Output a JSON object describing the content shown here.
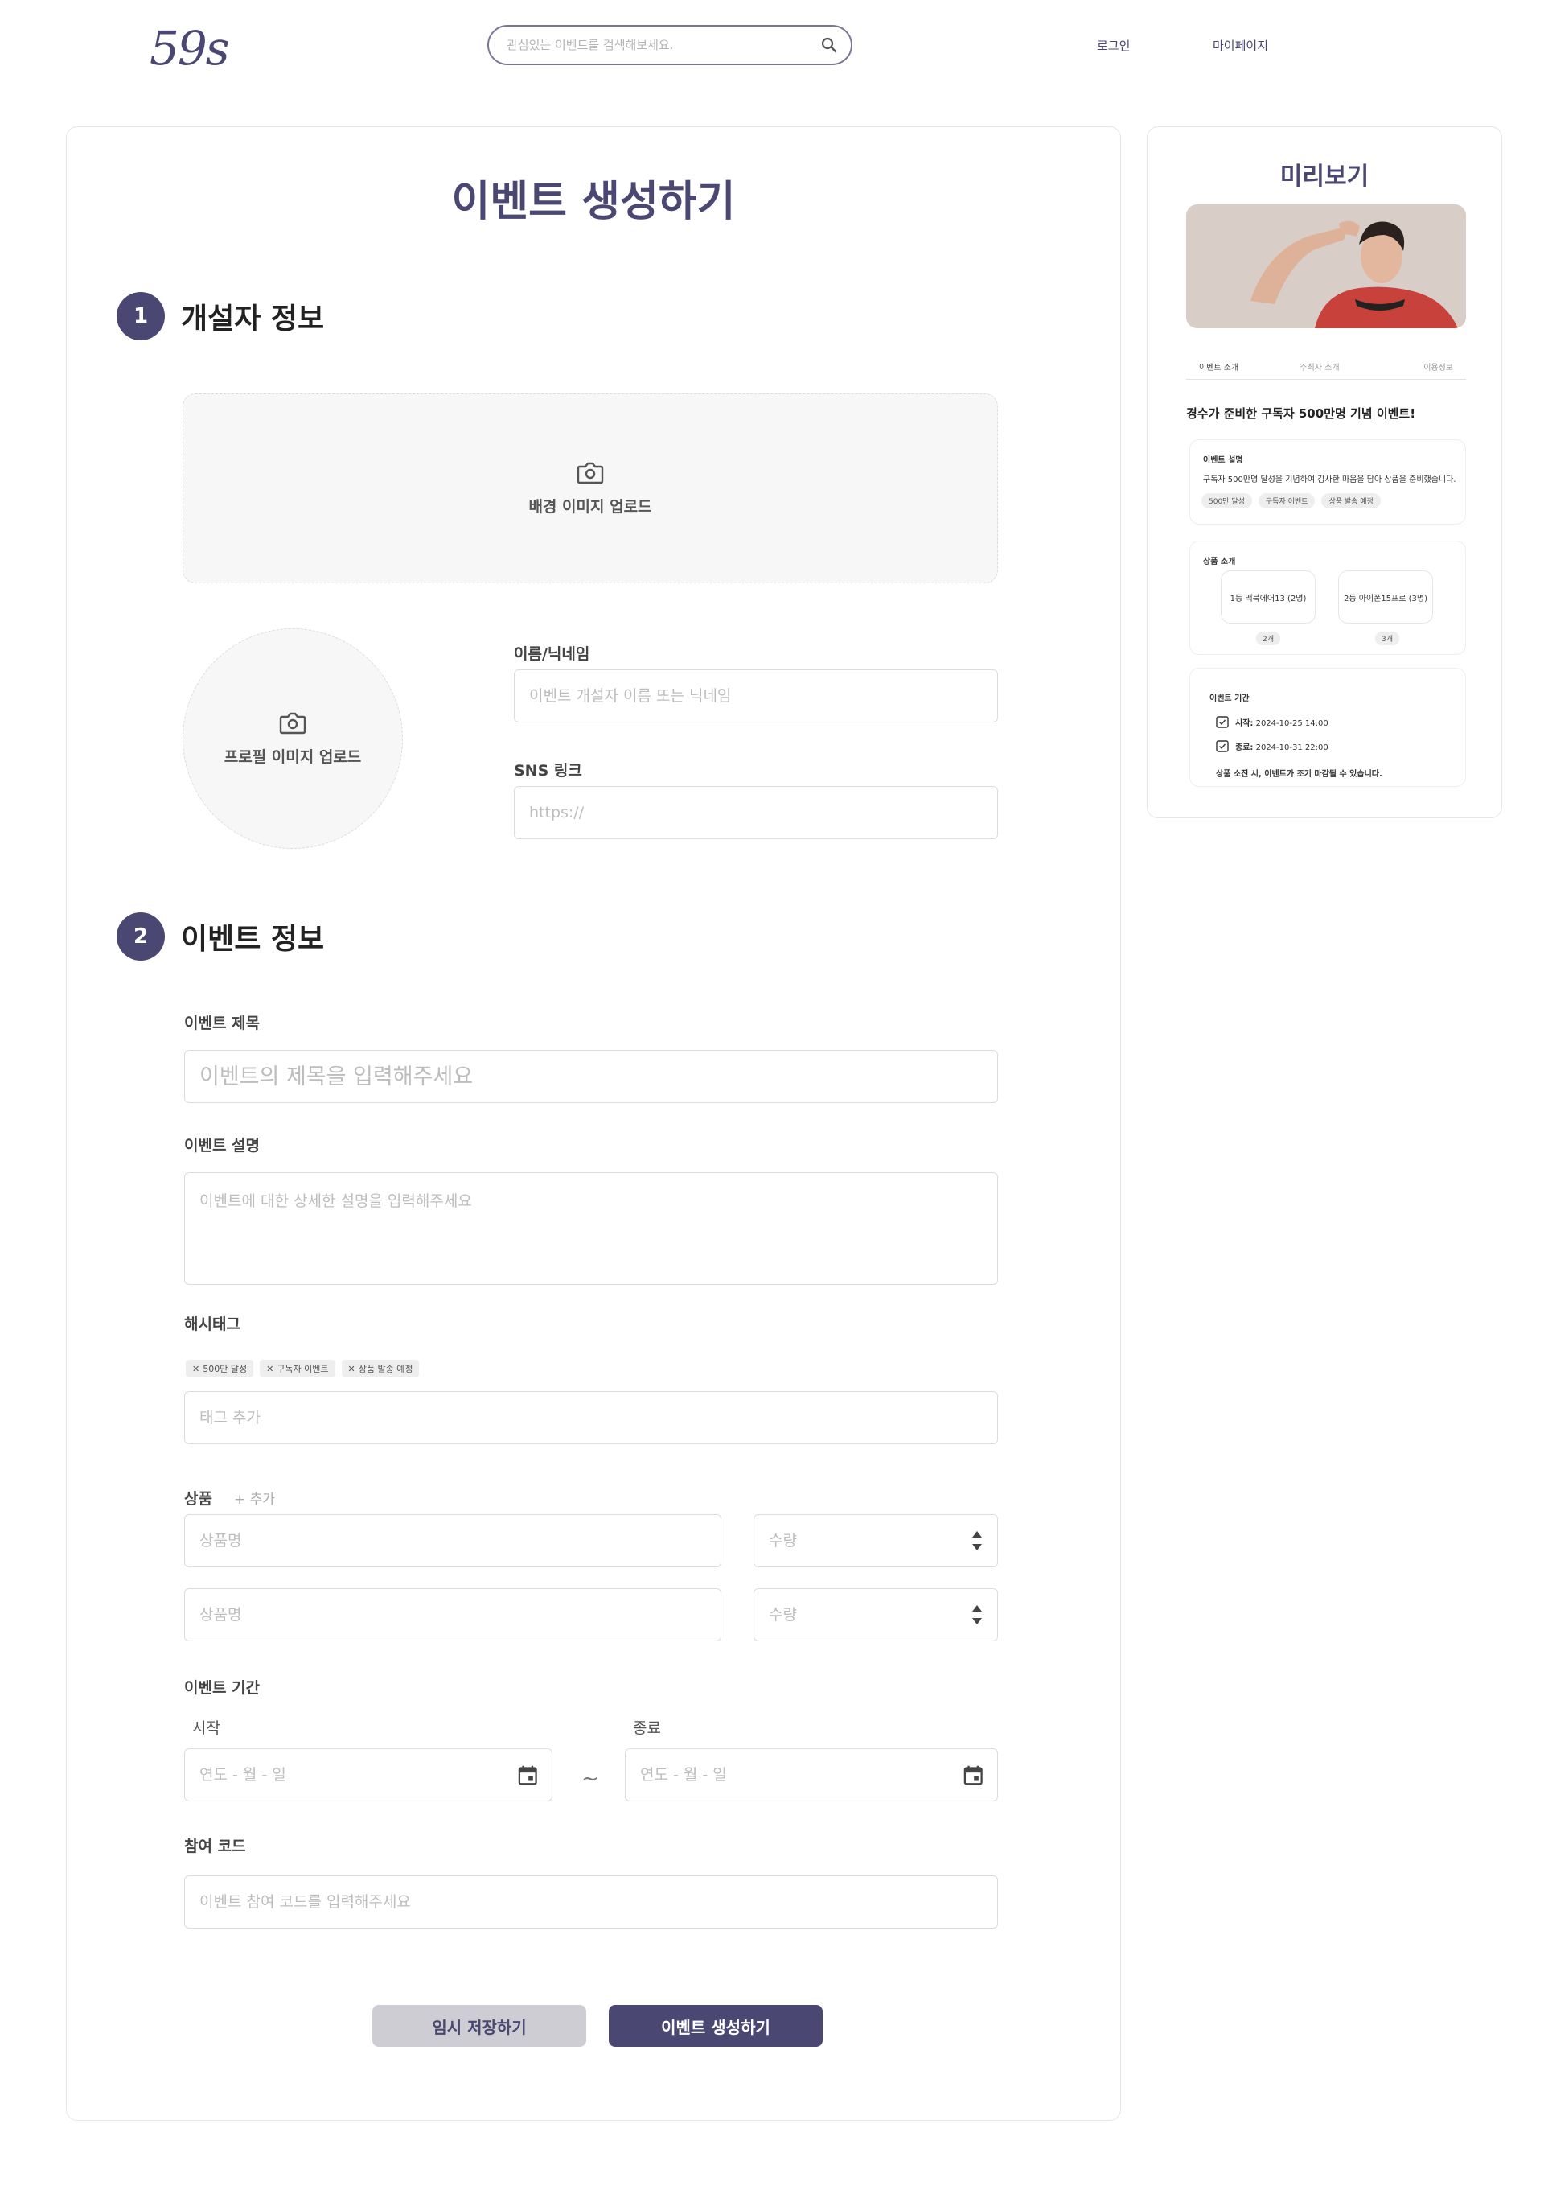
{
  "header": {
    "logo": "59s",
    "search_placeholder": "관심있는 이벤트를 검색해보세요.",
    "nav_login": "로그인",
    "nav_mypage": "마이페이지"
  },
  "form": {
    "page_title": "이벤트 생성하기",
    "section1": {
      "step": "1",
      "title": "개설자 정보"
    },
    "background_upload_label": "배경 이미지 업로드",
    "profile_upload_label": "프로필 이미지 업로드",
    "name_label": "이름/닉네임",
    "name_placeholder": "이벤트 개설자 이름 또는 닉네임",
    "sns_label": "SNS 링크",
    "sns_placeholder": "https://",
    "section2": {
      "step": "2",
      "title": "이벤트 정보"
    },
    "event_title_label": "이벤트 제목",
    "event_title_placeholder": "이벤트의 제목을 입력해주세요",
    "event_desc_label": "이벤트 설명",
    "event_desc_placeholder": "이벤트에 대한 상세한 설명을 입력해주세요",
    "hashtag_label": "해시태그",
    "hashtags": [
      "500만 달성",
      "구독자 이벤트",
      "상품 발송 예정"
    ],
    "tag_placeholder": "태그 추가",
    "product_label": "상품",
    "product_add": "+ 추가",
    "product_rows": [
      {
        "name_placeholder": "상품명",
        "qty_placeholder": "수량"
      },
      {
        "name_placeholder": "상품명",
        "qty_placeholder": "수량"
      }
    ],
    "period_label": "이벤트 기간",
    "start_label": "시작",
    "end_label": "종료",
    "date_placeholder": "연도 - 월 - 일",
    "tilde": "~",
    "code_label": "참여 코드",
    "code_placeholder": "이벤트 참여 코드를 입력해주세요",
    "btn_draft": "임시 저장하기",
    "btn_create": "이벤트 생성하기"
  },
  "preview": {
    "title": "미리보기",
    "tabs": [
      "이벤트 소개",
      "주최자 소개",
      "이용정보"
    ],
    "headline": "경수가 준비한 구독자 500만명 기념 이벤트!",
    "desc_card": {
      "title": "이벤트 설명",
      "text": "구독자 500만명 달성을 기념하여 감사한 마음을 담아 상품을 준비했습니다.",
      "tags": [
        "500만 달성",
        "구독자 이벤트",
        "상품 발송 예정"
      ]
    },
    "product_card": {
      "title": "상품 소개",
      "items": [
        {
          "name": "1등 맥북에어13 (2명)",
          "count": "2개"
        },
        {
          "name": "2등 아이폰15프로 (3명)",
          "count": "3개"
        }
      ]
    },
    "period_card": {
      "title": "이벤트 기간",
      "start_label": "시작:",
      "start_value": "2024-10-25 14:00",
      "end_label": "종료:",
      "end_value": "2024-10-31 22:00",
      "note": "상품 소진 시, 이벤트가 조기 마감될 수 있습니다."
    }
  },
  "colors": {
    "accent": "#4a4773",
    "secondary_button": "#cdcdd3",
    "upload_bg": "#f7f7f7"
  }
}
